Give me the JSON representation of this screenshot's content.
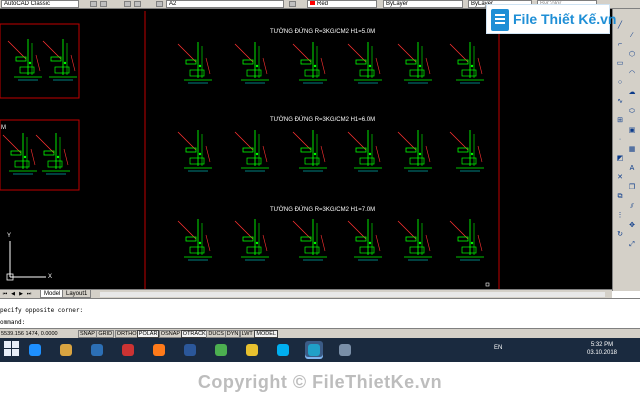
{
  "toolbar": {
    "workspace": "AutoCAD Classic",
    "viewport_name": "A2",
    "color": "Red",
    "linetype": "ByLayer",
    "lineweight": "ByLayer",
    "plotstyle": "ByColor",
    "brand_color": "#ff0000"
  },
  "watermark_logo": {
    "text": "File Thiết Kế.vn",
    "accent": "#1f8fd6"
  },
  "drawing": {
    "section_titles": [
      "TƯỜNG ĐỨNG R=3KG/CM2 H1=5.0M",
      "TƯỜNG ĐỨNG R=3KG/CM2 H1=6.0M",
      "TƯỜNG ĐỨNG R=3KG/CM2 H1=7.0M"
    ],
    "side_label": "M",
    "ucs": {
      "x_label": "X",
      "y_label": "Y"
    },
    "line_colors": {
      "frame": "#c00000",
      "geometry": "#00ff00",
      "text": "#ffffff",
      "hatch": "#ff3030",
      "dim": "#00ffff"
    }
  },
  "palette": {
    "tools": [
      "line-icon",
      "construction-line-icon",
      "polyline-icon",
      "polygon-icon",
      "rectangle-icon",
      "arc-icon",
      "circle-icon",
      "revision-cloud-icon",
      "spline-icon",
      "ellipse-icon",
      "insert-block-icon",
      "make-block-icon",
      "point-icon",
      "hatch-icon",
      "region-icon",
      "multiline-text-icon",
      "erase-icon",
      "copy-icon",
      "mirror-icon",
      "offset-icon",
      "array-icon",
      "move-icon",
      "rotate-icon",
      "scale-icon"
    ]
  },
  "tabs": {
    "items": [
      "Model",
      "Layout1"
    ],
    "active": "Model"
  },
  "command": {
    "line1": "pecify opposite corner:",
    "line2": "ommand:"
  },
  "status": {
    "coordinates": "5539.156 1474, 0.0000",
    "toggles": [
      {
        "label": "SNAP",
        "on": false
      },
      {
        "label": "GRID",
        "on": false
      },
      {
        "label": "ORTHO",
        "on": false
      },
      {
        "label": "POLAR",
        "on": true
      },
      {
        "label": "OSNAP",
        "on": false
      },
      {
        "label": "OTRACK",
        "on": true
      },
      {
        "label": "DUCS",
        "on": false
      },
      {
        "label": "DYN",
        "on": false
      },
      {
        "label": "LWT",
        "on": false
      },
      {
        "label": "MODEL",
        "on": true
      }
    ]
  },
  "taskbar": {
    "apps": [
      "internet-explorer-icon",
      "library-icon",
      "notepad-icon",
      "snagit-icon",
      "firefox-icon",
      "word-icon",
      "greenshot-icon",
      "chrome-icon",
      "skype-icon",
      "autocad-icon",
      "unikey-icon"
    ],
    "active_app": "autocad-icon",
    "language": "EN",
    "time": "5:32 PM",
    "date": "03.10.2018"
  },
  "footer": {
    "copyright": "Copyright © FileThietKe.vn"
  }
}
